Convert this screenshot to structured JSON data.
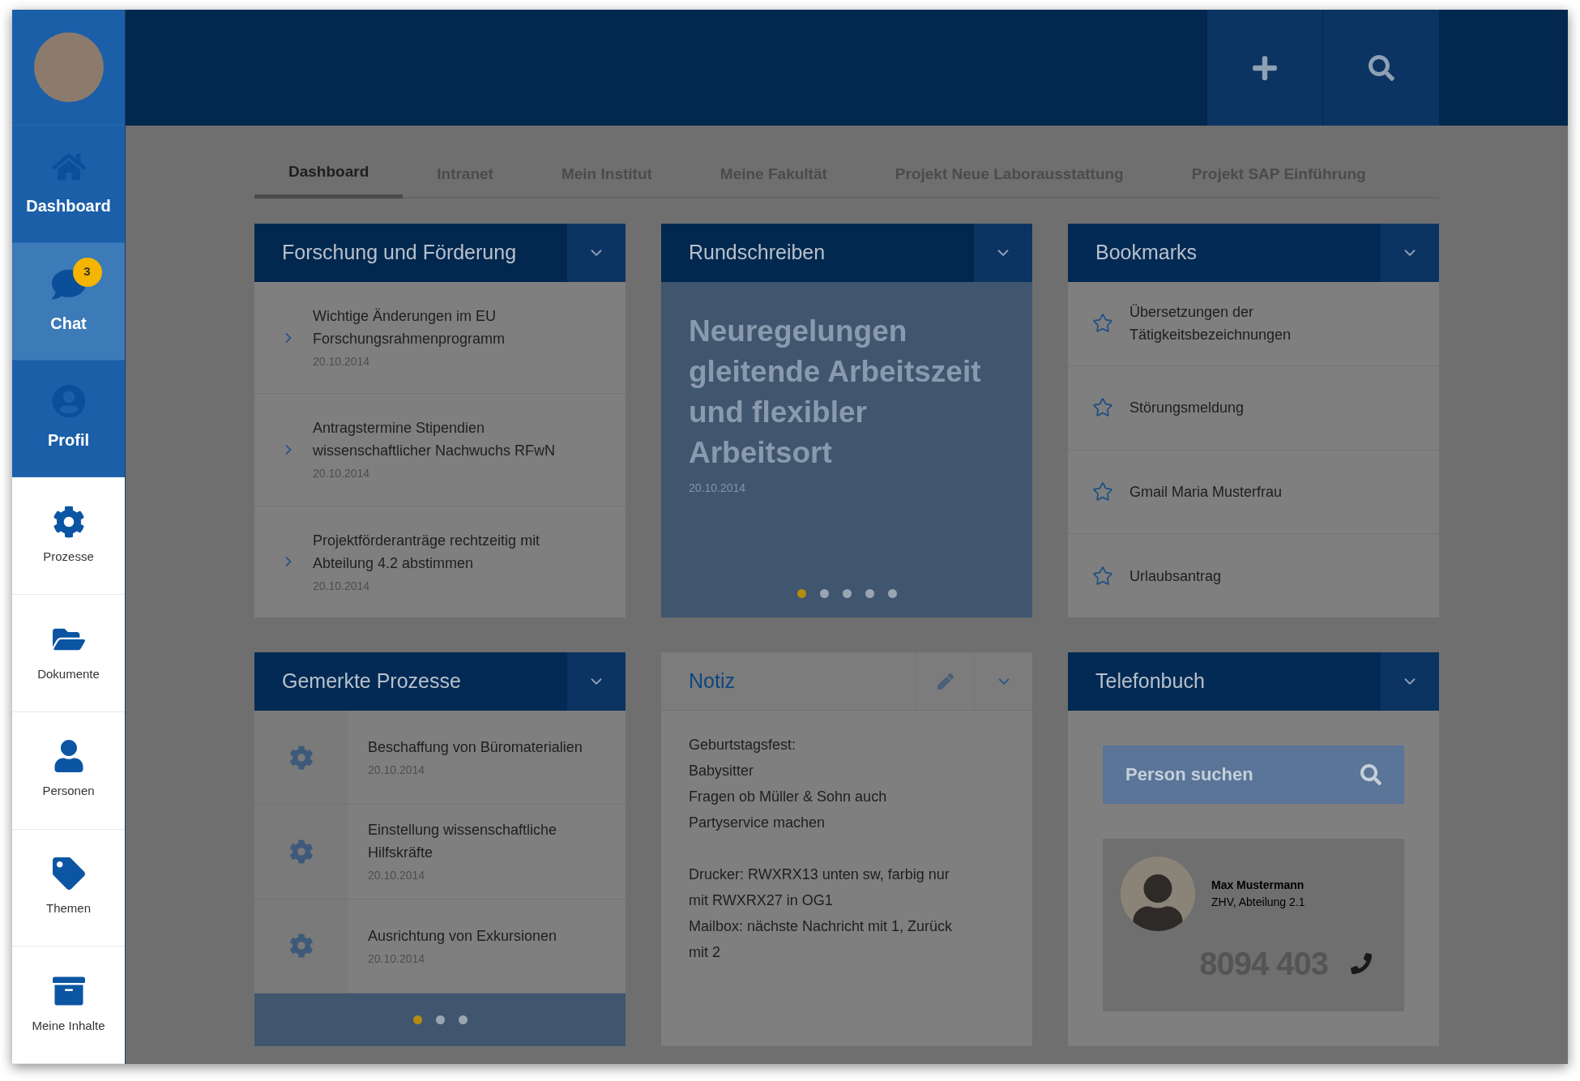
{
  "sidebar": {
    "items": [
      {
        "label": "Dashboard",
        "kind": "main",
        "selected": false
      },
      {
        "label": "Chat",
        "kind": "main",
        "selected": true,
        "badge": "3"
      },
      {
        "label": "Profil",
        "kind": "main",
        "selected": false
      },
      {
        "label": "Prozesse",
        "kind": "more",
        "selected": false
      },
      {
        "label": "Dokumente",
        "kind": "more",
        "selected": false
      },
      {
        "label": "Personen",
        "kind": "more",
        "selected": false
      },
      {
        "label": "Themen",
        "kind": "more",
        "selected": false
      },
      {
        "label": "Meine Inhalte",
        "kind": "more",
        "selected": false
      }
    ]
  },
  "tabs": [
    {
      "label": "Dashboard",
      "selected": true
    },
    {
      "label": "Intranet",
      "selected": false
    },
    {
      "label": "Mein Institut",
      "selected": false
    },
    {
      "label": "Meine Fakultät",
      "selected": false
    },
    {
      "label": "Projekt Neue Laborausstattung",
      "selected": false
    },
    {
      "label": "Projekt SAP Einführung",
      "selected": false
    }
  ],
  "cards": [
    {
      "kind": "news",
      "title": "Forschung und Förderung",
      "items": [
        {
          "text": "Wichtige Änderungen im EU Forschungsrahmenprogramm",
          "date": "20.10.2014"
        },
        {
          "text": "Antragstermine Stipendien wissenschaftlicher Nachwuchs RFwN",
          "date": "20.10.2014"
        },
        {
          "text": "Projektförderanträge rechtzeitig mit Abteilung 4.2 abstimmen",
          "date": "20.10.2014"
        }
      ]
    },
    {
      "kind": "carousel",
      "title": "Rundschreiben",
      "headline": "Neuregelungen gleitende Arbeitszeit und flexibler Arbeitsort",
      "date": "20.10.2014",
      "pages": [
        {
          "selected": true
        },
        {
          "selected": false
        },
        {
          "selected": false
        },
        {
          "selected": false
        },
        {
          "selected": false
        }
      ]
    },
    {
      "kind": "bookmarks",
      "title": "Bookmarks",
      "items": [
        "Übersetzungen der Tätigkeitsbezeichnungen",
        "Störungsmeldung",
        "Gmail Maria Musterfrau",
        "Urlaubsantrag"
      ]
    },
    {
      "kind": "processes",
      "title": "Gemerkte Prozesse",
      "items": [
        {
          "text": "Beschaffung von Büromaterialien",
          "date": "20.10.2014"
        },
        {
          "text": "Einstellung wissenschaftliche Hilfskräfte",
          "date": "20.10.2014"
        },
        {
          "text": "Ausrichtung von Exkursionen",
          "date": "20.10.2014"
        }
      ],
      "pages": [
        {
          "selected": true
        },
        {
          "selected": false
        },
        {
          "selected": false
        }
      ]
    },
    {
      "kind": "note",
      "title": "Notiz",
      "paragraphs": [
        [
          "Geburtstagsfest:",
          "Babysitter",
          "Fragen ob Müller & Sohn auch",
          "Partyservice machen"
        ],
        [
          "Drucker: RWXRX13 unten sw, farbig nur",
          "mit RWXRX27 in OG1",
          "Mailbox: nächste Nachricht mit 1, Zurück",
          "mit 2"
        ]
      ]
    },
    {
      "kind": "phonebook",
      "title": "Telefonbuch",
      "search_placeholder": "Person suchen",
      "contact": {
        "name": "Max Mustermann",
        "department": "ZHV, Abteilung 2.1",
        "phone": "8094 403"
      }
    }
  ]
}
